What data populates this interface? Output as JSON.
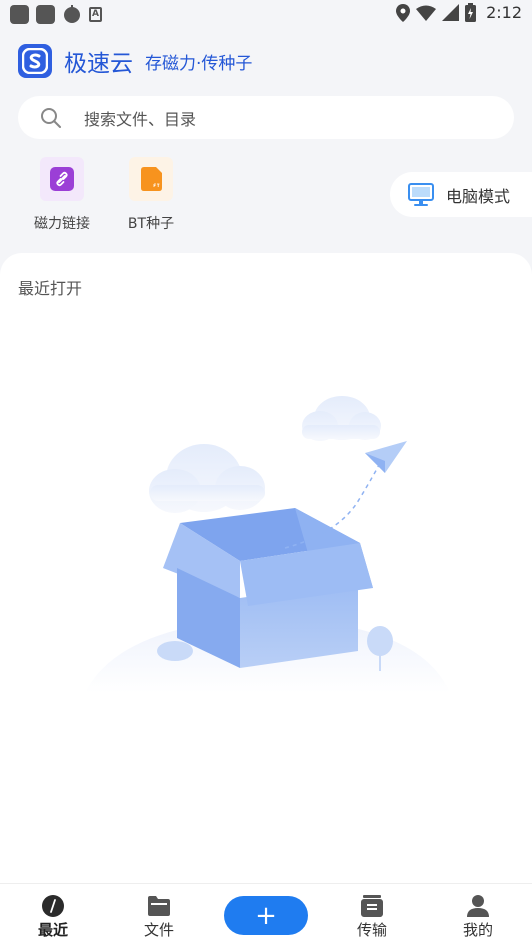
{
  "status_bar": {
    "time": "2:12",
    "left_icons": [
      "notification-icon",
      "notification-icon",
      "notification-icon",
      "text-icon"
    ],
    "text_icon_glyph": "A",
    "right_icons": [
      "location-icon",
      "wifi-icon",
      "signal-icon",
      "battery-icon"
    ]
  },
  "header": {
    "app_name": "极速云",
    "slogan": "存磁力·传种子",
    "logo_letter": "S"
  },
  "search": {
    "placeholder": "搜索文件、目录"
  },
  "tools": [
    {
      "label": "磁力链接",
      "icon": "link-icon",
      "color": "#9b3fd6"
    },
    {
      "label": "BT种子",
      "icon": "bt-file-icon",
      "color": "#f7931e"
    }
  ],
  "pc_mode": {
    "label": "电脑模式",
    "icon": "monitor-icon"
  },
  "recent": {
    "title": "最近打开"
  },
  "bottom_nav": {
    "items": [
      {
        "label": "最近",
        "icon": "compass-icon",
        "active": true
      },
      {
        "label": "文件",
        "icon": "folder-icon",
        "active": false
      },
      {
        "label": "传输",
        "icon": "inbox-icon",
        "active": false
      },
      {
        "label": "我的",
        "icon": "user-icon",
        "active": false
      }
    ],
    "fab_symbol": "+"
  },
  "colors": {
    "brand": "#2457d6",
    "accent": "#1f7cf0",
    "background": "#f4f5f8"
  }
}
